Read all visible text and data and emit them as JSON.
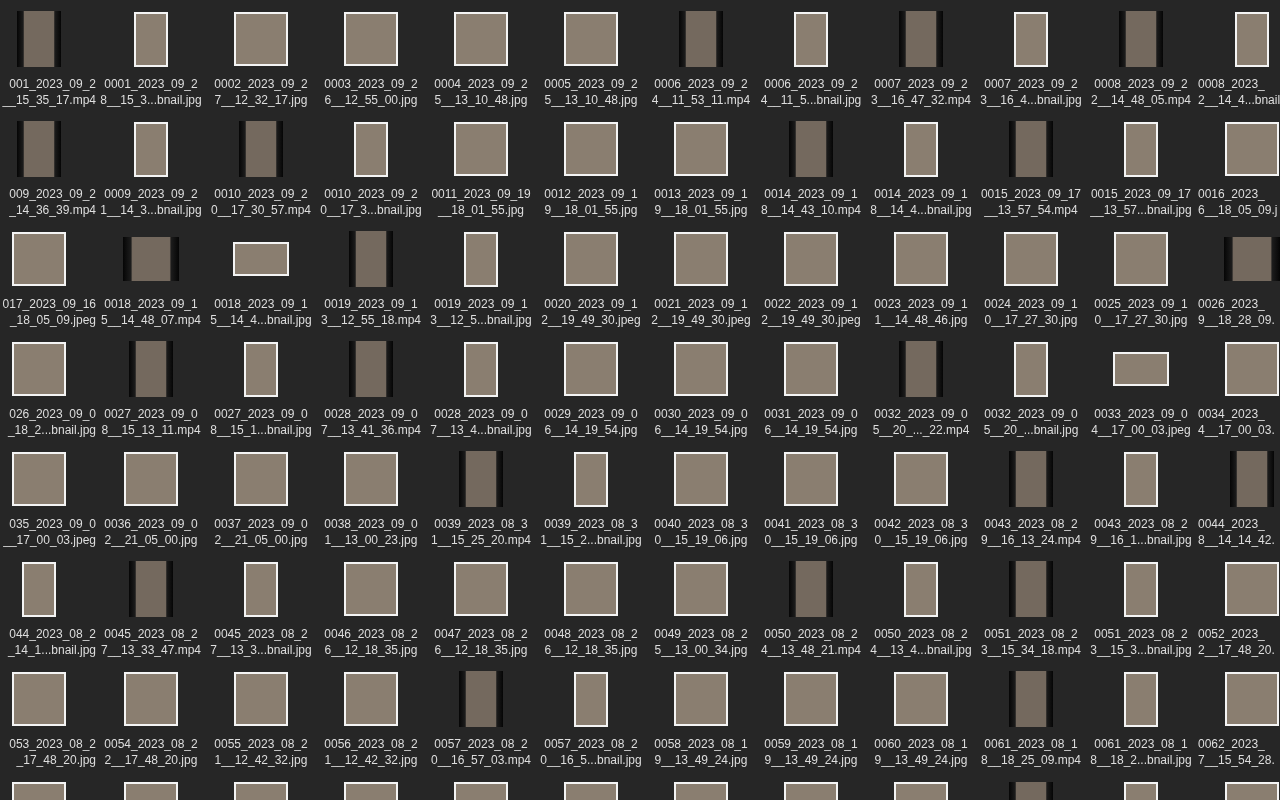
{
  "files": [
    {
      "label": [
        "001_2023_09_2",
        "__15_35_17.mp4"
      ],
      "kind": "video"
    },
    {
      "label": [
        "0001_2023_09_2",
        "8__15_3...bnail.jpg"
      ],
      "kind": "tallphoto"
    },
    {
      "label": [
        "0002_2023_09_2",
        "7__12_32_17.jpg"
      ],
      "kind": "photo"
    },
    {
      "label": [
        "0003_2023_09_2",
        "6__12_55_00.jpg"
      ],
      "kind": "photo"
    },
    {
      "label": [
        "0004_2023_09_2",
        "5__13_10_48.jpg"
      ],
      "kind": "photo"
    },
    {
      "label": [
        "0005_2023_09_2",
        "5__13_10_48.jpg"
      ],
      "kind": "photo"
    },
    {
      "label": [
        "0006_2023_09_2",
        "4__11_53_11.mp4"
      ],
      "kind": "video"
    },
    {
      "label": [
        "0006_2023_09_2",
        "4__11_5...bnail.jpg"
      ],
      "kind": "tallphoto"
    },
    {
      "label": [
        "0007_2023_09_2",
        "3__16_47_32.mp4"
      ],
      "kind": "video"
    },
    {
      "label": [
        "0007_2023_09_2",
        "3__16_4...bnail.jpg"
      ],
      "kind": "tallphoto"
    },
    {
      "label": [
        "0008_2023_09_2",
        "2__14_48_05.mp4"
      ],
      "kind": "video"
    },
    {
      "label": [
        "0008_2023_",
        "2__14_4...bnail"
      ],
      "kind": "tallphoto"
    },
    {
      "label": [
        "009_2023_09_2",
        "_14_36_39.mp4"
      ],
      "kind": "video"
    },
    {
      "label": [
        "0009_2023_09_2",
        "1__14_3...bnail.jpg"
      ],
      "kind": "tallphoto"
    },
    {
      "label": [
        "0010_2023_09_2",
        "0__17_30_57.mp4"
      ],
      "kind": "video"
    },
    {
      "label": [
        "0010_2023_09_2",
        "0__17_3...bnail.jpg"
      ],
      "kind": "tallphoto"
    },
    {
      "label": [
        "0011_2023_09_19",
        "__18_01_55.jpg"
      ],
      "kind": "photo"
    },
    {
      "label": [
        "0012_2023_09_1",
        "9__18_01_55.jpg"
      ],
      "kind": "photo"
    },
    {
      "label": [
        "0013_2023_09_1",
        "9__18_01_55.jpg"
      ],
      "kind": "photo"
    },
    {
      "label": [
        "0014_2023_09_1",
        "8__14_43_10.mp4"
      ],
      "kind": "video"
    },
    {
      "label": [
        "0014_2023_09_1",
        "8__14_4...bnail.jpg"
      ],
      "kind": "tallphoto"
    },
    {
      "label": [
        "0015_2023_09_17",
        "__13_57_54.mp4"
      ],
      "kind": "video"
    },
    {
      "label": [
        "0015_2023_09_17",
        "__13_57...bnail.jpg"
      ],
      "kind": "tallphoto"
    },
    {
      "label": [
        "0016_2023_",
        "6__18_05_09.j"
      ],
      "kind": "photo"
    },
    {
      "label": [
        "017_2023_09_16",
        "_18_05_09.jpeg"
      ],
      "kind": "photo"
    },
    {
      "label": [
        "0018_2023_09_1",
        "5__14_48_07.mp4"
      ],
      "kind": "widevideo"
    },
    {
      "label": [
        "0018_2023_09_1",
        "5__14_4...bnail.jpg"
      ],
      "kind": "widephoto"
    },
    {
      "label": [
        "0019_2023_09_1",
        "3__12_55_18.mp4"
      ],
      "kind": "video"
    },
    {
      "label": [
        "0019_2023_09_1",
        "3__12_5...bnail.jpg"
      ],
      "kind": "tallphoto"
    },
    {
      "label": [
        "0020_2023_09_1",
        "2__19_49_30.jpeg"
      ],
      "kind": "photo"
    },
    {
      "label": [
        "0021_2023_09_1",
        "2__19_49_30.jpeg"
      ],
      "kind": "photo"
    },
    {
      "label": [
        "0022_2023_09_1",
        "2__19_49_30.jpeg"
      ],
      "kind": "photo"
    },
    {
      "label": [
        "0023_2023_09_1",
        "1__14_48_46.jpg"
      ],
      "kind": "photo"
    },
    {
      "label": [
        "0024_2023_09_1",
        "0__17_27_30.jpg"
      ],
      "kind": "photo"
    },
    {
      "label": [
        "0025_2023_09_1",
        "0__17_27_30.jpg"
      ],
      "kind": "photo"
    },
    {
      "label": [
        "0026_2023_",
        "9__18_28_09."
      ],
      "kind": "widevideo"
    },
    {
      "label": [
        "026_2023_09_0",
        "_18_2...bnail.jpg"
      ],
      "kind": "photo"
    },
    {
      "label": [
        "0027_2023_09_0",
        "8__15_13_11.mp4"
      ],
      "kind": "video"
    },
    {
      "label": [
        "0027_2023_09_0",
        "8__15_1...bnail.jpg"
      ],
      "kind": "tallphoto"
    },
    {
      "label": [
        "0028_2023_09_0",
        "7__13_41_36.mp4"
      ],
      "kind": "video"
    },
    {
      "label": [
        "0028_2023_09_0",
        "7__13_4...bnail.jpg"
      ],
      "kind": "tallphoto"
    },
    {
      "label": [
        "0029_2023_09_0",
        "6__14_19_54.jpg"
      ],
      "kind": "photo"
    },
    {
      "label": [
        "0030_2023_09_0",
        "6__14_19_54.jpg"
      ],
      "kind": "photo"
    },
    {
      "label": [
        "0031_2023_09_0",
        "6__14_19_54.jpg"
      ],
      "kind": "photo"
    },
    {
      "label": [
        "0032_2023_09_0",
        "5__20_..._22.mp4"
      ],
      "kind": "video"
    },
    {
      "label": [
        "0032_2023_09_0",
        "5__20_...bnail.jpg"
      ],
      "kind": "tallphoto"
    },
    {
      "label": [
        "0033_2023_09_0",
        "4__17_00_03.jpeg"
      ],
      "kind": "widephoto"
    },
    {
      "label": [
        "0034_2023_",
        "4__17_00_03."
      ],
      "kind": "photo"
    },
    {
      "label": [
        "035_2023_09_0",
        "__17_00_03.jpeg"
      ],
      "kind": "photo"
    },
    {
      "label": [
        "0036_2023_09_0",
        "2__21_05_00.jpg"
      ],
      "kind": "photo"
    },
    {
      "label": [
        "0037_2023_09_0",
        "2__21_05_00.jpg"
      ],
      "kind": "photo"
    },
    {
      "label": [
        "0038_2023_09_0",
        "1__13_00_23.jpg"
      ],
      "kind": "photo"
    },
    {
      "label": [
        "0039_2023_08_3",
        "1__15_25_20.mp4"
      ],
      "kind": "video"
    },
    {
      "label": [
        "0039_2023_08_3",
        "1__15_2...bnail.jpg"
      ],
      "kind": "tallphoto"
    },
    {
      "label": [
        "0040_2023_08_3",
        "0__15_19_06.jpg"
      ],
      "kind": "photo"
    },
    {
      "label": [
        "0041_2023_08_3",
        "0__15_19_06.jpg"
      ],
      "kind": "photo"
    },
    {
      "label": [
        "0042_2023_08_3",
        "0__15_19_06.jpg"
      ],
      "kind": "photo"
    },
    {
      "label": [
        "0043_2023_08_2",
        "9__16_13_24.mp4"
      ],
      "kind": "video"
    },
    {
      "label": [
        "0043_2023_08_2",
        "9__16_1...bnail.jpg"
      ],
      "kind": "tallphoto"
    },
    {
      "label": [
        "0044_2023_",
        "8__14_14_42."
      ],
      "kind": "video"
    },
    {
      "label": [
        "044_2023_08_2",
        "_14_1...bnail.jpg"
      ],
      "kind": "tallphoto"
    },
    {
      "label": [
        "0045_2023_08_2",
        "7__13_33_47.mp4"
      ],
      "kind": "video"
    },
    {
      "label": [
        "0045_2023_08_2",
        "7__13_3...bnail.jpg"
      ],
      "kind": "tallphoto"
    },
    {
      "label": [
        "0046_2023_08_2",
        "6__12_18_35.jpg"
      ],
      "kind": "photo"
    },
    {
      "label": [
        "0047_2023_08_2",
        "6__12_18_35.jpg"
      ],
      "kind": "photo"
    },
    {
      "label": [
        "0048_2023_08_2",
        "6__12_18_35.jpg"
      ],
      "kind": "photo"
    },
    {
      "label": [
        "0049_2023_08_2",
        "5__13_00_34.jpg"
      ],
      "kind": "photo"
    },
    {
      "label": [
        "0050_2023_08_2",
        "4__13_48_21.mp4"
      ],
      "kind": "video"
    },
    {
      "label": [
        "0050_2023_08_2",
        "4__13_4...bnail.jpg"
      ],
      "kind": "tallphoto"
    },
    {
      "label": [
        "0051_2023_08_2",
        "3__15_34_18.mp4"
      ],
      "kind": "video"
    },
    {
      "label": [
        "0051_2023_08_2",
        "3__15_3...bnail.jpg"
      ],
      "kind": "tallphoto"
    },
    {
      "label": [
        "0052_2023_",
        "2__17_48_20."
      ],
      "kind": "photo"
    },
    {
      "label": [
        "053_2023_08_2",
        "_17_48_20.jpg"
      ],
      "kind": "photo"
    },
    {
      "label": [
        "0054_2023_08_2",
        "2__17_48_20.jpg"
      ],
      "kind": "photo"
    },
    {
      "label": [
        "0055_2023_08_2",
        "1__12_42_32.jpg"
      ],
      "kind": "photo"
    },
    {
      "label": [
        "0056_2023_08_2",
        "1__12_42_32.jpg"
      ],
      "kind": "photo"
    },
    {
      "label": [
        "0057_2023_08_2",
        "0__16_57_03.mp4"
      ],
      "kind": "video"
    },
    {
      "label": [
        "0057_2023_08_2",
        "0__16_5...bnail.jpg"
      ],
      "kind": "tallphoto"
    },
    {
      "label": [
        "0058_2023_08_1",
        "9__13_49_24.jpg"
      ],
      "kind": "photo"
    },
    {
      "label": [
        "0059_2023_08_1",
        "9__13_49_24.jpg"
      ],
      "kind": "photo"
    },
    {
      "label": [
        "0060_2023_08_1",
        "9__13_49_24.jpg"
      ],
      "kind": "photo"
    },
    {
      "label": [
        "0061_2023_08_1",
        "8__18_25_09.mp4"
      ],
      "kind": "video"
    },
    {
      "label": [
        "0061_2023_08_1",
        "8__18_2...bnail.jpg"
      ],
      "kind": "tallphoto"
    },
    {
      "label": [
        "0062_2023_",
        "7__15_54_28."
      ],
      "kind": "photo"
    }
  ],
  "cut_row": [
    {
      "kind": "photo"
    },
    {
      "kind": "photo"
    },
    {
      "kind": "photo"
    },
    {
      "kind": "photo"
    },
    {
      "kind": "photo"
    },
    {
      "kind": "photo"
    },
    {
      "kind": "photo"
    },
    {
      "kind": "photo"
    },
    {
      "kind": "photo"
    },
    {
      "kind": "video"
    },
    {
      "kind": "tallphoto"
    },
    {
      "kind": "photo"
    }
  ]
}
